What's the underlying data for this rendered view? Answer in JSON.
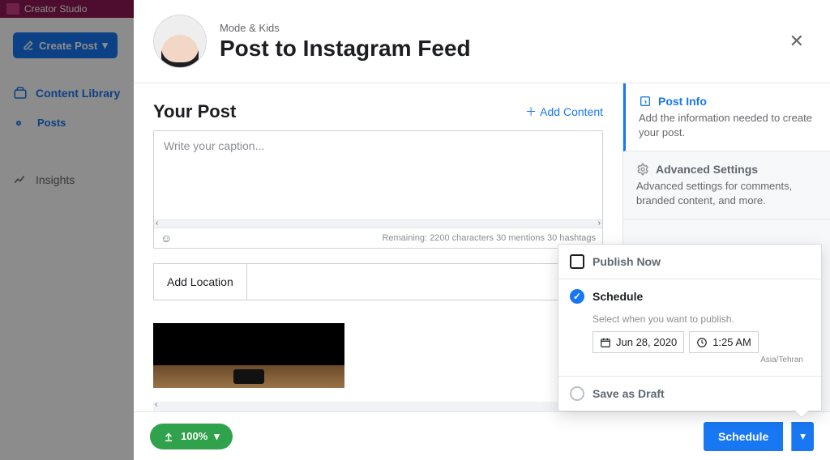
{
  "app": {
    "name": "Creator Studio"
  },
  "sidebar": {
    "create_post": "Create Post",
    "items": [
      {
        "label": "Content Library"
      },
      {
        "label": "Posts"
      },
      {
        "label": "Insights"
      }
    ]
  },
  "modal": {
    "account": "Mode & Kids",
    "title": "Post to Instagram Feed"
  },
  "post": {
    "heading": "Your Post",
    "add_content": "Add Content",
    "caption_placeholder": "Write your caption...",
    "remaining": "Remaining: 2200 characters 30 mentions 30 hashtags",
    "add_location": "Add Location"
  },
  "right_panel": {
    "post_info": {
      "title": "Post Info",
      "sub": "Add the information needed to create your post."
    },
    "advanced": {
      "title": "Advanced Settings",
      "sub": "Advanced settings for comments, branded content, and more."
    }
  },
  "popover": {
    "publish_now": "Publish Now",
    "schedule": "Schedule",
    "hint": "Select when you want to publish.",
    "date": "Jun 28, 2020",
    "time": "1:25 AM",
    "tz": "Asia/Tehran",
    "save_draft": "Save as Draft"
  },
  "footer": {
    "upload_pct": "100%",
    "schedule_btn": "Schedule"
  }
}
